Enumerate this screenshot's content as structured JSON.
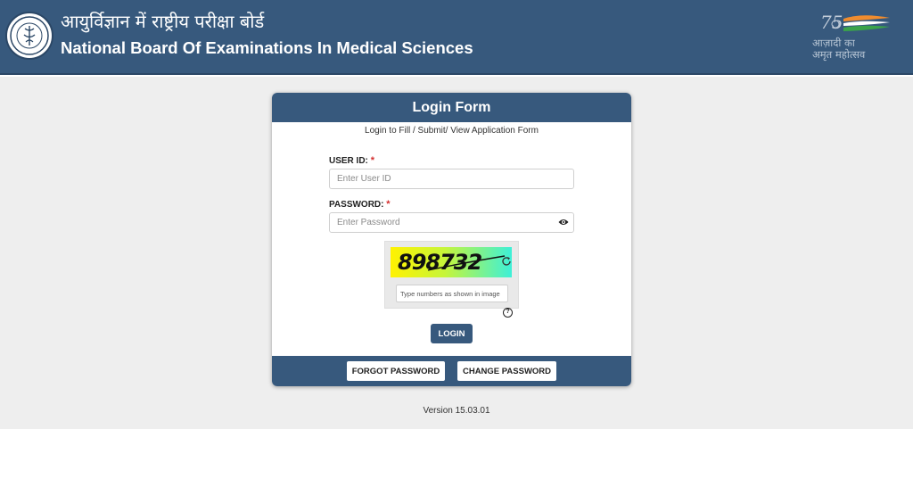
{
  "header": {
    "title_hindi": "आयुर्विज्ञान में राष्ट्रीय परीक्षा बोर्ड",
    "title_english": "National Board Of Examinations In Medical Sciences",
    "azadi_line1": "आज़ादी का",
    "azadi_line2": "अमृत महोत्सव",
    "azadi_number": "75"
  },
  "login_form": {
    "title": "Login Form",
    "subtitle": "Login to Fill / Submit/ View Application Form",
    "user_id_label": "USER ID:",
    "user_id_placeholder": "Enter User ID",
    "password_label": "PASSWORD:",
    "password_placeholder": "Enter Password",
    "required_mark": "*",
    "captcha_value": "898732",
    "captcha_placeholder": "Type numbers as shown in image",
    "help_symbol": "?",
    "login_button": "LOGIN",
    "forgot_password_button": "FORGOT PASSWORD",
    "change_password_button": "CHANGE PASSWORD"
  },
  "footer": {
    "version": "Version 15.03.01"
  },
  "icons": {
    "logo": "nbe-emblem-icon",
    "eye": "eye-icon",
    "refresh": "refresh-icon",
    "help": "help-icon",
    "azadi": "azadi-ka-amrit-mahotsav-logo"
  },
  "colors": {
    "brand": "#37597d",
    "page_background": "#eeeeee",
    "required": "#d32f2f",
    "captcha_gradient_start": "#fff200",
    "captcha_gradient_end": "#3df0d8"
  }
}
